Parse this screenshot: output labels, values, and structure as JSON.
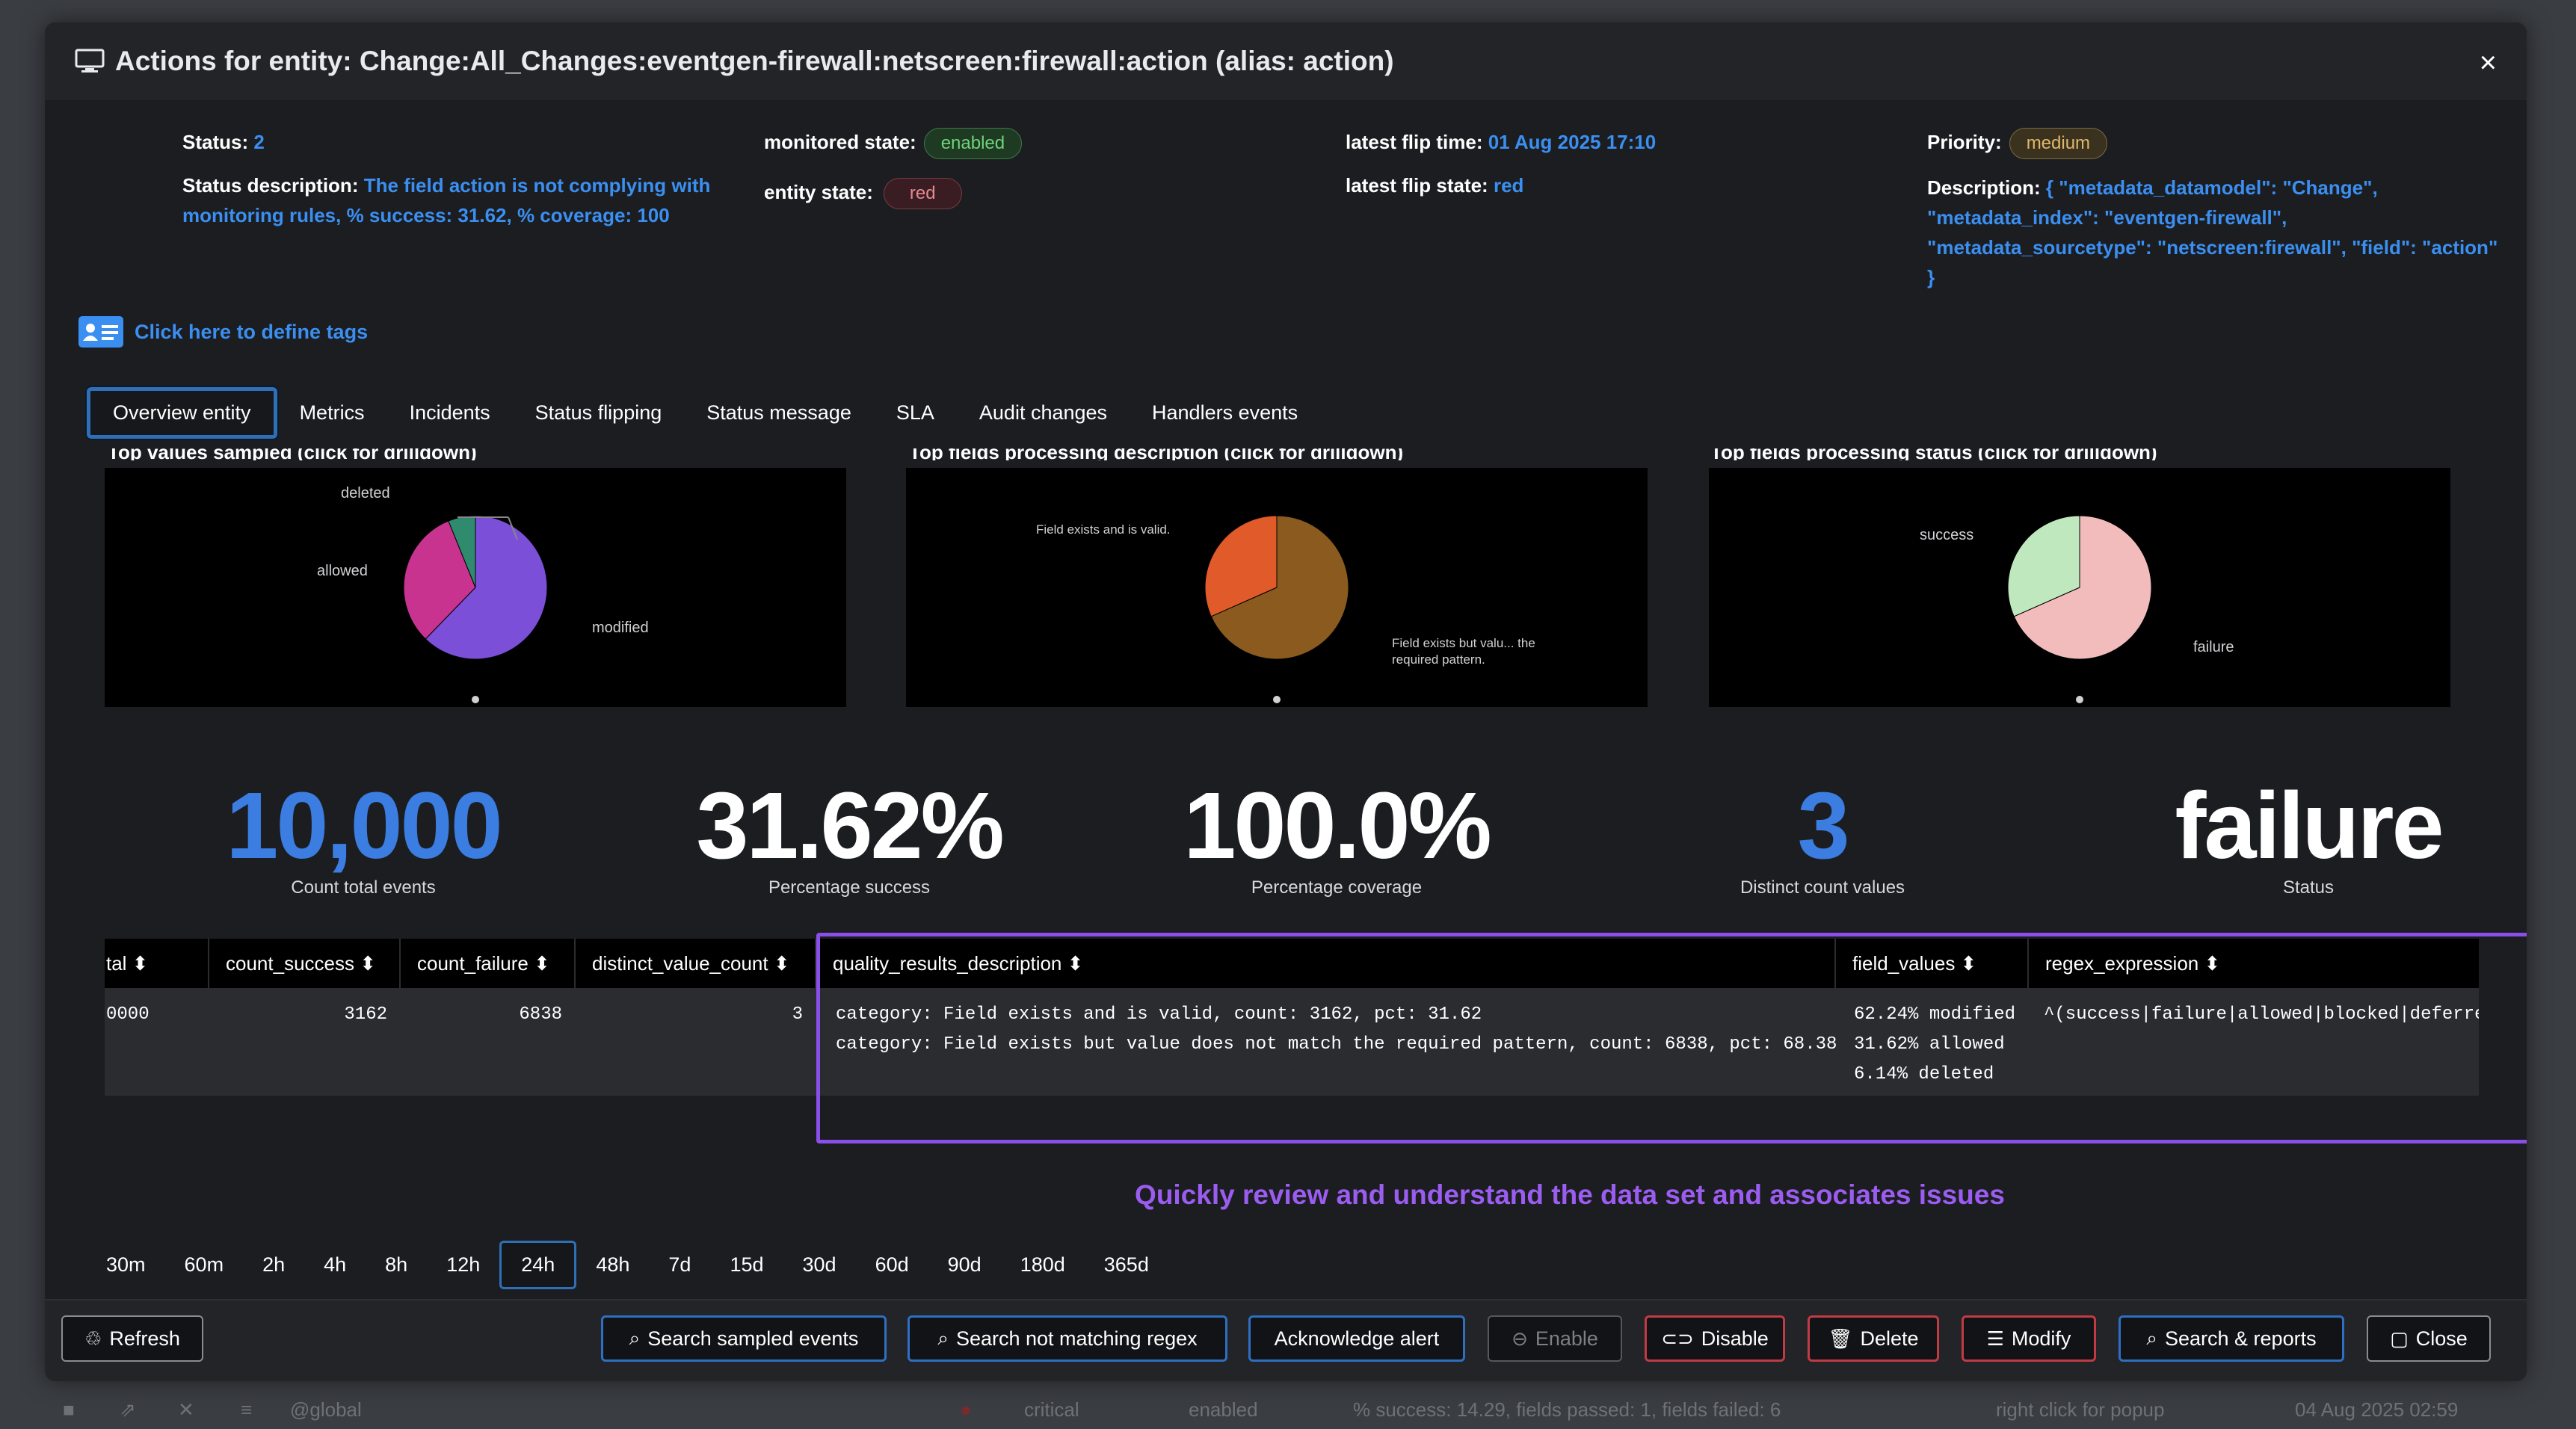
{
  "modal": {
    "title": "Actions for entity: Change:All_Changes:eventgen-firewall:netscreen:firewall:action (alias: action)",
    "close": "×"
  },
  "info": {
    "status_label": "Status:",
    "status_value": "2",
    "status_desc_label": "Status description:",
    "status_desc_line1": "The field action is not complying with",
    "status_desc_line2": "monitoring rules, % success: 31.62, % coverage: 100",
    "monitored_state_label": "monitored state:",
    "monitored_state_value": "enabled",
    "entity_state_label": "entity state:",
    "entity_state_value": "red",
    "latest_flip_time_label": "latest flip time:",
    "latest_flip_time_value": "01 Aug 2025 17:10",
    "latest_flip_state_label": "latest flip state:",
    "latest_flip_state_value": "red",
    "priority_label": "Priority:",
    "priority_value": "medium",
    "description_label": "Description:",
    "description_line1": "{ \"metadata_datamodel\": \"Change\",",
    "description_line2": "\"metadata_index\": \"eventgen-firewall\",",
    "description_line3": "\"metadata_sourcetype\": \"netscreen:firewall\", \"field\": \"action\"",
    "description_line4": "}"
  },
  "tags_link": "Click here to define tags",
  "tabs": [
    "Overview entity",
    "Metrics",
    "Incidents",
    "Status flipping",
    "Status message",
    "SLA",
    "Audit changes",
    "Handlers events"
  ],
  "chart_titles": [
    "Top values sampled (click for drilldown)",
    "Top fields processing description (click for drilldown)",
    "Top fields processing status (click for drilldown)"
  ],
  "chart_data": [
    {
      "type": "pie",
      "title": "Top values sampled (click for drilldown)",
      "slices": [
        {
          "label": "modified",
          "value": 62.24,
          "color": "#7b4fd8"
        },
        {
          "label": "allowed",
          "value": 31.62,
          "color": "#c7338f"
        },
        {
          "label": "deleted",
          "value": 6.14,
          "color": "#2f8a6e"
        }
      ]
    },
    {
      "type": "pie",
      "title": "Top fields processing description (click for drilldown)",
      "slices": [
        {
          "label": "Field exists but valu... the required pattern.",
          "value": 68.38,
          "color": "#8a5a1e"
        },
        {
          "label": "Field exists and is valid.",
          "value": 31.62,
          "color": "#e05a2a"
        }
      ]
    },
    {
      "type": "pie",
      "title": "Top fields processing status (click for drilldown)",
      "slices": [
        {
          "label": "failure",
          "value": 68.38,
          "color": "#f2bcbc"
        },
        {
          "label": "success",
          "value": 31.62,
          "color": "#bfe8bf"
        }
      ]
    }
  ],
  "pie_labels": {
    "c1_deleted": "deleted",
    "c1_allowed": "allowed",
    "c1_modified": "modified",
    "c2_valid": "Field exists and is valid.",
    "c2_notmatch_1": "Field exists but valu... the",
    "c2_notmatch_2": "required pattern.",
    "c3_success": "success",
    "c3_failure": "failure"
  },
  "kpis": [
    {
      "value": "10,000",
      "label": "Count total events",
      "color": "#3b7de0"
    },
    {
      "value": "31.62%",
      "label": "Percentage success",
      "color": "#ffffff"
    },
    {
      "value": "100.0%",
      "label": "Percentage coverage",
      "color": "#ffffff"
    },
    {
      "value": "3",
      "label": "Distinct count values",
      "color": "#3b7de0"
    },
    {
      "value": "failure",
      "label": "Status",
      "color": "#ffffff"
    }
  ],
  "table": {
    "headers": [
      "tal ⬍",
      "count_success ⬍",
      "count_failure ⬍",
      "distinct_value_count ⬍",
      "quality_results_description ⬍",
      "field_values ⬍",
      "regex_expression ⬍"
    ],
    "row": {
      "total": "0000",
      "count_success": "3162",
      "count_failure": "6838",
      "distinct_value_count": "3",
      "quality_results_description": "category: Field exists and is valid, count: 3162, pct: 31.62\ncategory: Field exists but value does not match the required pattern, count: 6838, pct: 68.38",
      "field_values": "62.24% modified\n31.62% allowed\n6.14% deleted",
      "regex_expression": "^(success|failure|allowed|blocked|deferred)$"
    }
  },
  "callout": "Quickly review and understand the data set and associates issues",
  "ranges": [
    "30m",
    "60m",
    "2h",
    "4h",
    "8h",
    "12h",
    "24h",
    "48h",
    "7d",
    "15d",
    "30d",
    "60d",
    "90d",
    "180d",
    "365d"
  ],
  "buttons": {
    "refresh": "Refresh",
    "search_sampled": "Search sampled events",
    "search_not_matching": "Search not matching regex",
    "acknowledge": "Acknowledge alert",
    "enable": "Enable",
    "disable": "Disable",
    "delete": "Delete",
    "modify": "Modify",
    "search_reports": "Search & reports",
    "close": "Close"
  },
  "background_row": {
    "app": "@global",
    "priority": "critical",
    "state": "enabled",
    "message": "% success: 14.29, fields passed: 1, fields failed: 6",
    "hint": "right click for popup",
    "time": "04 Aug 2025 02:59"
  }
}
